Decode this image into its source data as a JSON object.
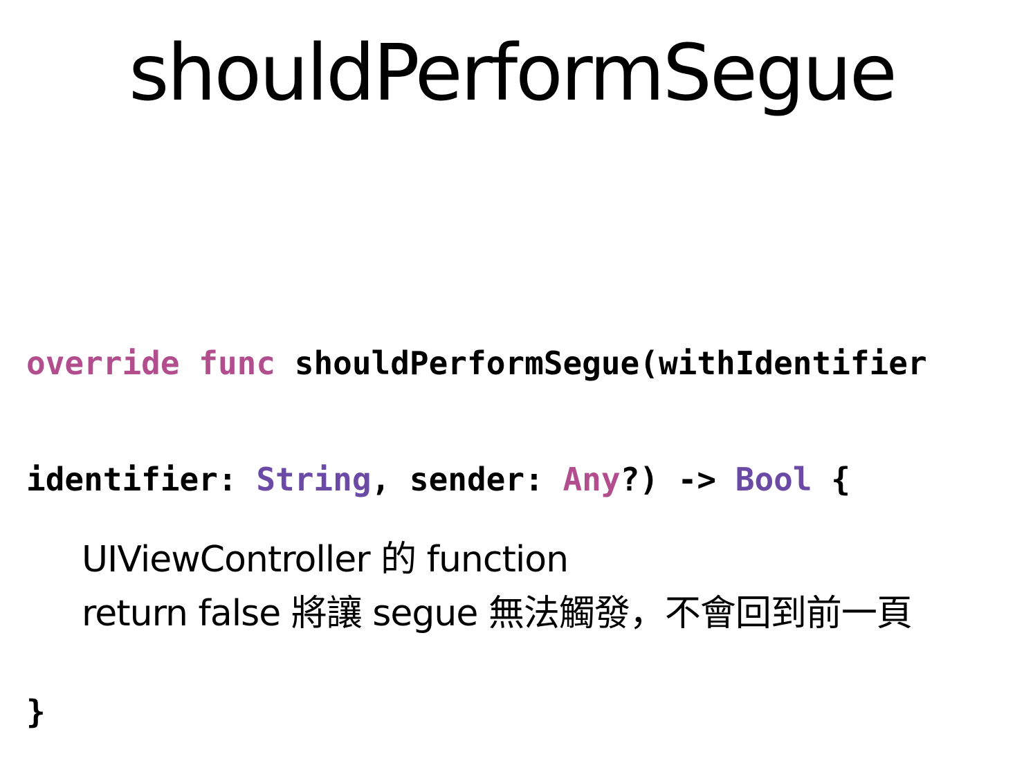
{
  "slide": {
    "title": "shouldPerformSegue"
  },
  "code": {
    "line1": {
      "kw_override": "override",
      "kw_func": "func",
      "signature": "shouldPerformSegue(withIdentifier"
    },
    "line2": {
      "param": "identifier:",
      "type_string": "String",
      "sep_sender": ", sender:",
      "type_any": "Any",
      "arrow": "?) ->",
      "type_bool": "Bool",
      "open_brace": "{"
    },
    "line3": "",
    "line4": {
      "close_brace": "}"
    }
  },
  "caption": {
    "line1": "UIViewController 的 function",
    "line2": "return false 將讓 segue 無法觸發，不會回到前一頁"
  },
  "colors": {
    "keyword": "#b24e8e",
    "type": "#6b4aa6",
    "text": "#000000",
    "background": "#ffffff"
  }
}
